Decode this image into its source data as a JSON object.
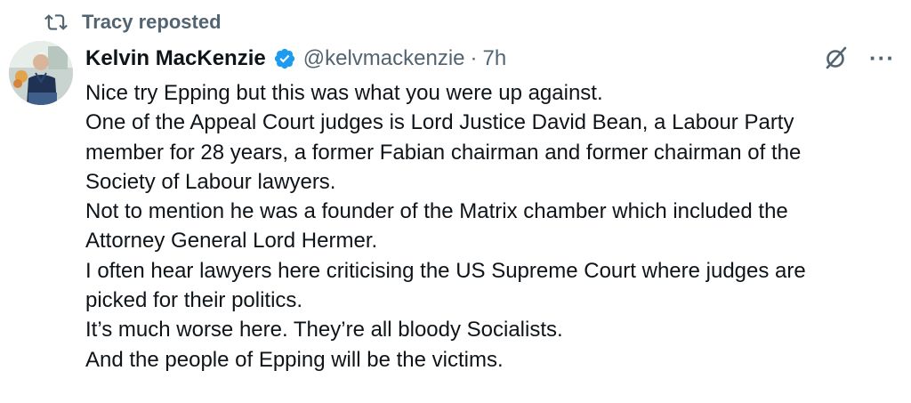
{
  "repost": {
    "label": "Tracy reposted",
    "icon": "retweet-icon"
  },
  "author": {
    "display_name": "Kelvin MacKenzie",
    "verified": true,
    "verified_color": "#1d9bf0",
    "handle": "@kelvmackenzie",
    "separator": "·",
    "time": "7h"
  },
  "actions": {
    "grok_icon": "grok-icon",
    "more_label": "···"
  },
  "tweet": {
    "lines": [
      "Nice try Epping but this was what you were up against.",
      "One of the Appeal Court judges is Lord Justice David Bean, a Labour Party",
      "member for 28 years, a former Fabian chairman and former chairman of the",
      "Society of Labour lawyers.",
      "Not to mention he was a founder of the Matrix chamber which included the",
      "Attorney General Lord Hermer.",
      "I often hear lawyers here criticising the US Supreme Court where judges are",
      "picked for their politics.",
      "It’s much worse here. They’re all bloody Socialists.",
      "And the people of Epping will be the victims."
    ]
  },
  "colors": {
    "text": "#0f1419",
    "muted": "#536471",
    "accent": "#1d9bf0"
  }
}
